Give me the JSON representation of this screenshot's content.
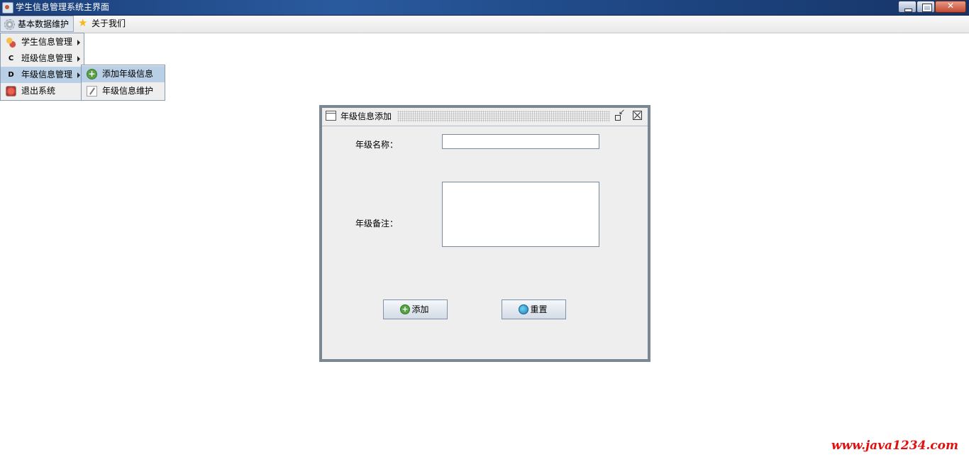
{
  "window": {
    "title": "学生信息管理系统主界面"
  },
  "menubar": {
    "items": [
      {
        "label": "基本数据维护",
        "icon": "gear-icon"
      },
      {
        "label": "关于我们",
        "icon": "star-icon"
      }
    ]
  },
  "menu_basic": {
    "items": [
      {
        "label": "学生信息管理",
        "icon": "students-icon"
      },
      {
        "label": "班级信息管理",
        "icon_letter": "C"
      },
      {
        "label": "年级信息管理",
        "icon_letter": "D"
      },
      {
        "label": "退出系统",
        "icon": "exit-icon"
      }
    ]
  },
  "submenu_grade": {
    "items": [
      {
        "label": "添加年级信息",
        "icon": "add-icon"
      },
      {
        "label": "年级信息维护",
        "icon": "edit-icon"
      }
    ]
  },
  "grade_dialog": {
    "title": "年级信息添加",
    "name_label": "年级名称：",
    "name_value": "",
    "remark_label": "年级备注：",
    "remark_value": "",
    "add_label": "添加",
    "reset_label": "重置"
  },
  "watermark": "www.java1234.com",
  "colors": {
    "title_bar": "#1f4a88",
    "menu_highlight": "#b8cfe5",
    "frame_border": "#7c8794",
    "watermark": "#e01010"
  }
}
